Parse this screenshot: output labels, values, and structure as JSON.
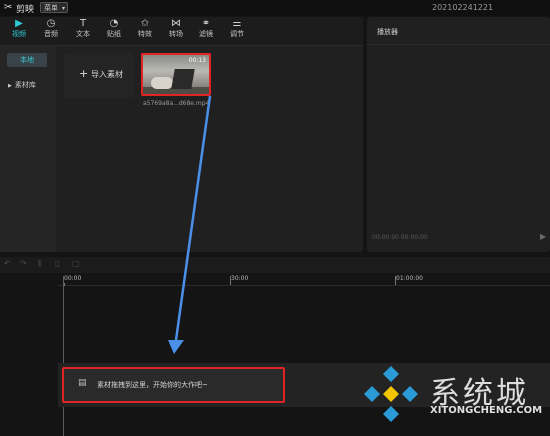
{
  "app": {
    "name": "剪映",
    "menu_label": "菜单",
    "project_name": "202102241221"
  },
  "toolbar": {
    "tabs": [
      {
        "label": "视频",
        "icon": "video-icon",
        "active": true
      },
      {
        "label": "音频",
        "icon": "audio-icon",
        "active": false
      },
      {
        "label": "文本",
        "icon": "text-icon",
        "active": false
      },
      {
        "label": "贴纸",
        "icon": "sticker-icon",
        "active": false
      },
      {
        "label": "特效",
        "icon": "effects-icon",
        "active": false
      },
      {
        "label": "转场",
        "icon": "transition-icon",
        "active": false
      },
      {
        "label": "滤镜",
        "icon": "filter-icon",
        "active": false
      },
      {
        "label": "调节",
        "icon": "adjust-icon",
        "active": false
      }
    ]
  },
  "sidebar": {
    "items": [
      {
        "label": "本地",
        "active": true
      },
      {
        "label": "素材库",
        "active": false
      }
    ]
  },
  "media": {
    "import_label": "导入素材",
    "clips": [
      {
        "name": "a5769a8a...d68e.mp4",
        "duration": "00:13"
      }
    ]
  },
  "player": {
    "title": "播放器",
    "timecode": "00:00:00  00:00:00"
  },
  "timeline": {
    "ticks": [
      "00:00",
      "30:00",
      "01:00:00"
    ],
    "drop_hint": "素材拖拽到这里，开始你的大作吧~"
  },
  "watermark": {
    "text": "系统城",
    "url": "XITONGCHENG.COM"
  },
  "colors": {
    "accent": "#2ecbd6",
    "highlight": "#e02424",
    "arrow": "#4a8fe8"
  }
}
